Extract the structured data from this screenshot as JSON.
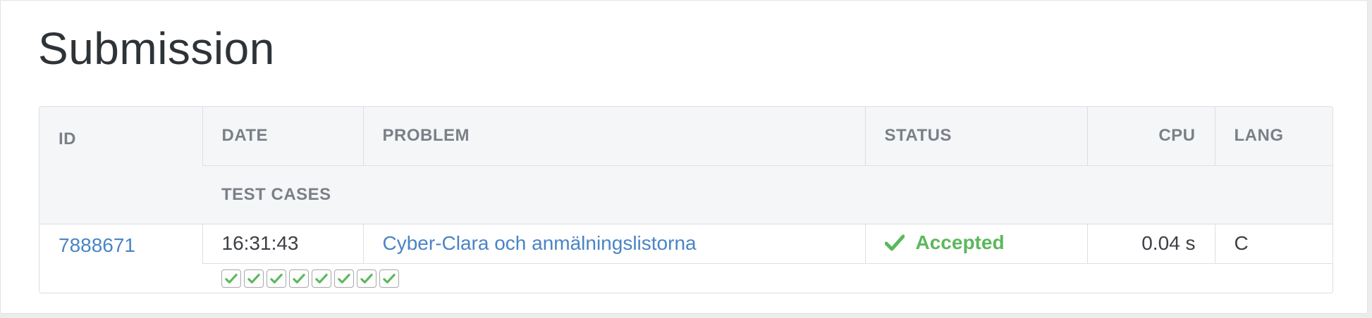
{
  "page": {
    "title": "Submission"
  },
  "table": {
    "headers": {
      "id": "ID",
      "date": "DATE",
      "problem": "PROBLEM",
      "status": "STATUS",
      "cpu": "CPU",
      "lang": "LANG",
      "test_cases": "TEST CASES"
    },
    "row": {
      "id": "7888671",
      "date": "16:31:43",
      "problem": "Cyber-Clara och anmälningslistorna",
      "status": "Accepted",
      "cpu": "0.04 s",
      "lang": "C",
      "test_cases": [
        "accepted",
        "accepted",
        "accepted",
        "accepted",
        "accepted",
        "accepted",
        "accepted",
        "accepted"
      ]
    }
  },
  "colors": {
    "accepted": "#5cb85c",
    "link": "#4a84c5",
    "header_bg": "#f5f6f8"
  },
  "icons": {
    "status": "check-icon",
    "test_case": "check-icon"
  }
}
